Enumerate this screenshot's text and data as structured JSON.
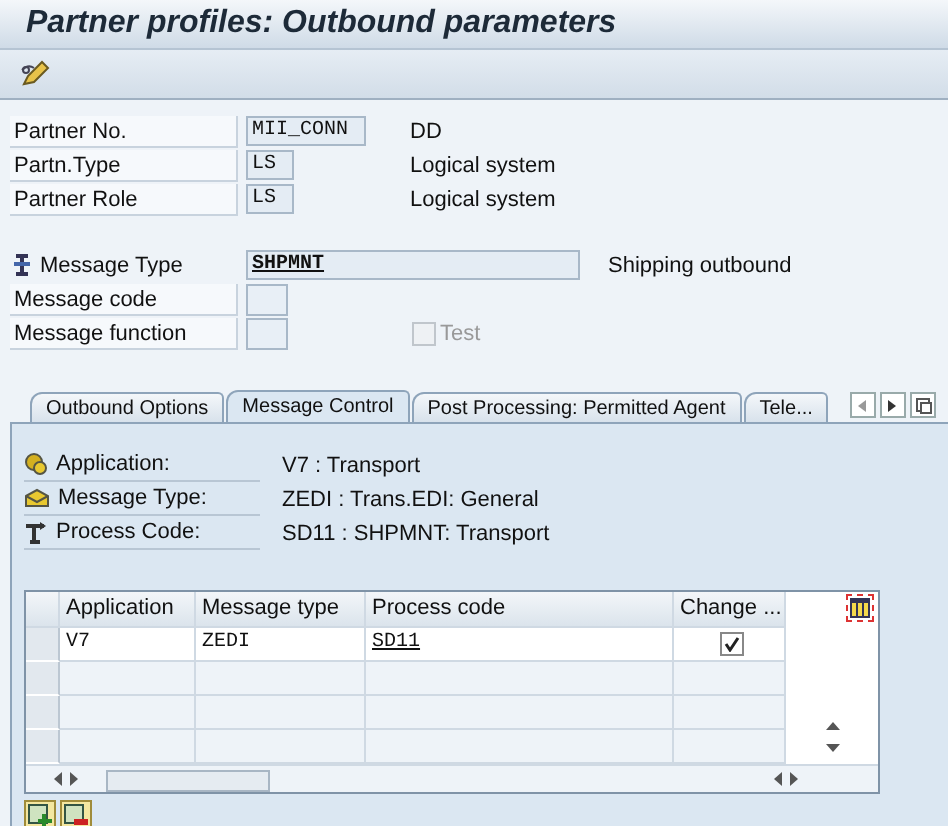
{
  "window": {
    "title": "Partner profiles: Outbound parameters"
  },
  "partner_fields": [
    {
      "label": "Partner No.",
      "value": "MII_CONN",
      "description": "DD"
    },
    {
      "label": "Partn.Type",
      "value": "LS",
      "description": "Logical system"
    },
    {
      "label": "Partner Role",
      "value": "LS",
      "description": "Logical system"
    }
  ],
  "message_fields": [
    {
      "kind": "key",
      "label": "Message Type",
      "value": "SHPMNT",
      "description": "Shipping outbound"
    },
    {
      "kind": "plain",
      "label": "Message code"
    },
    {
      "kind": "plain",
      "label": "Message function",
      "checkbox": {
        "label": "Test",
        "checked": false,
        "disabled": true
      }
    }
  ],
  "tabs": [
    {
      "label": "Outbound Options",
      "selected": false
    },
    {
      "label": "Message Control",
      "selected": true
    },
    {
      "label": "Post Processing: Permitted Agent",
      "selected": false
    },
    {
      "label": "Tele...",
      "selected": false
    }
  ],
  "message_control": [
    {
      "kind": "application",
      "label": "Application:",
      "value": "V7 : Transport"
    },
    {
      "kind": "message_type",
      "label": "Message Type:",
      "value": "ZEDI : Trans.EDI: General"
    },
    {
      "kind": "process_code",
      "label": "Process Code:",
      "value": "SD11 : SHPMNT: Transport"
    }
  ],
  "table": {
    "columns": [
      "Application",
      "Message type",
      "Process code",
      "Change ..."
    ],
    "rows": [
      {
        "application": "V7",
        "message_type": "ZEDI",
        "process_code": "SD11",
        "change": true
      }
    ]
  }
}
